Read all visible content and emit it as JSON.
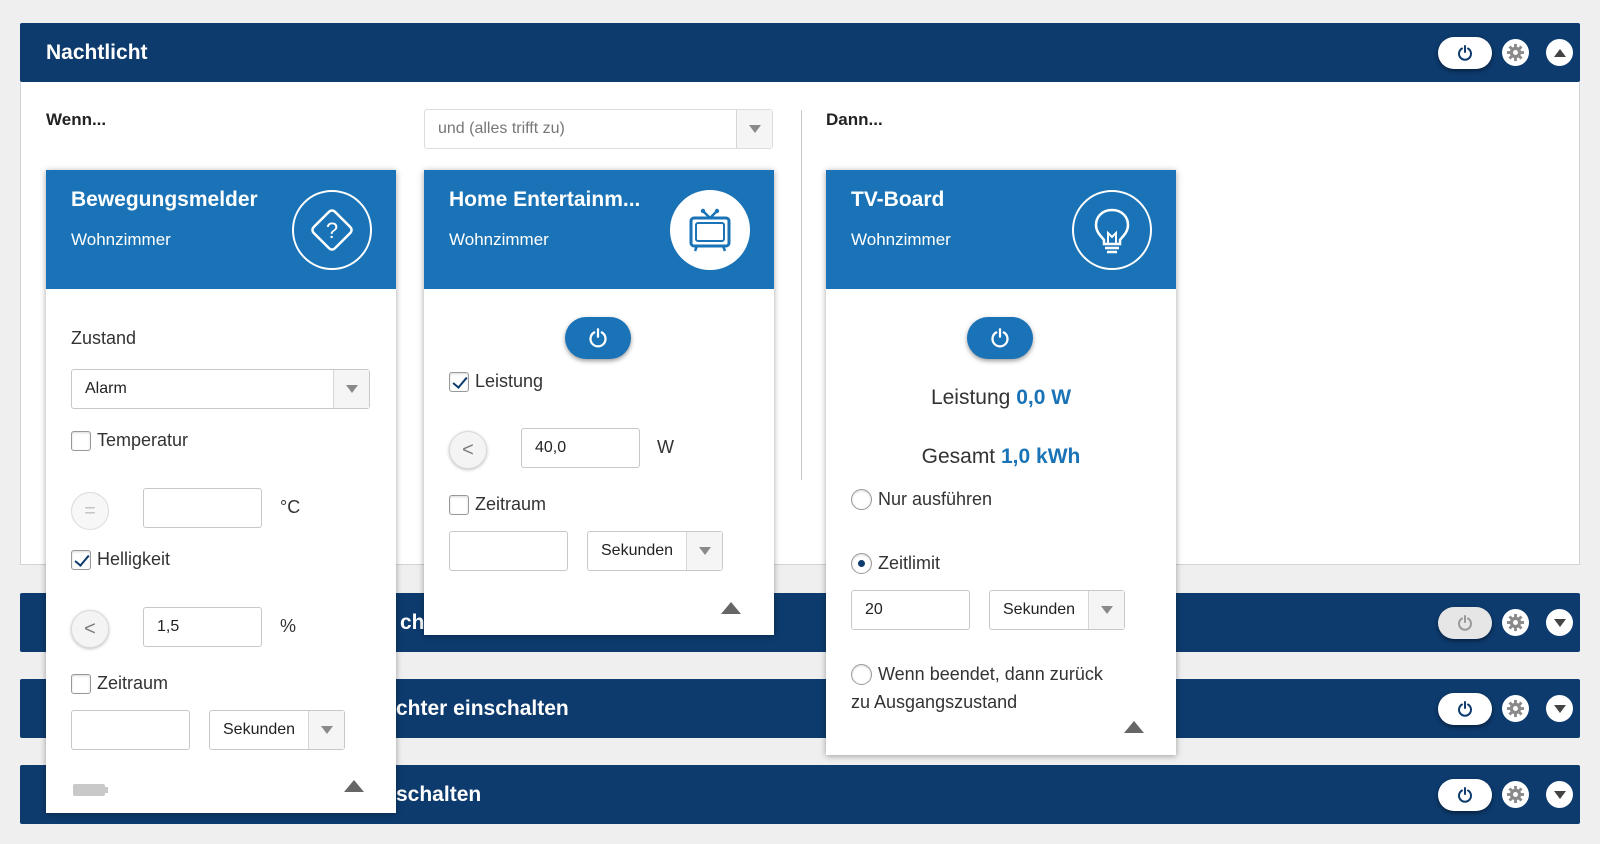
{
  "rules": [
    {
      "title": "Nachtlicht",
      "expanded": true
    },
    {
      "title": "…ch…",
      "expanded": false,
      "power": "off"
    },
    {
      "title": "…chter einschalten",
      "expanded": false,
      "power": "on"
    },
    {
      "title": "…schalten",
      "expanded": false,
      "power": "on"
    }
  ],
  "condition": {
    "when_label": "Wenn...",
    "logic_select": "und (alles trifft zu)",
    "then_label": "Dann..."
  },
  "card_motion": {
    "title": "Bewegungsmelder",
    "room": "Wohnzimmer",
    "icon": "unknown-device-icon",
    "state_label": "Zustand",
    "state_value": "Alarm",
    "temperature": {
      "label": "Temperatur",
      "checked": false,
      "operator": "=",
      "value": "",
      "unit": "°C"
    },
    "brightness": {
      "label": "Helligkeit",
      "checked": true,
      "operator": "<",
      "value": "1,5",
      "unit": "%"
    },
    "period": {
      "label": "Zeitraum",
      "checked": false,
      "value": "",
      "unit_select": "Sekunden"
    }
  },
  "card_home": {
    "title": "Home Entertainm...",
    "room": "Wohnzimmer",
    "icon": "tv-icon",
    "power": {
      "label": "Leistung",
      "checked": true,
      "operator": "<",
      "value": "40,0",
      "unit": "W"
    },
    "period": {
      "label": "Zeitraum",
      "checked": false,
      "value": "",
      "unit_select": "Sekunden"
    }
  },
  "card_tv": {
    "title": "TV-Board",
    "room": "Wohnzimmer",
    "icon": "lightbulb-icon",
    "power_label": "Leistung",
    "power_value": "0,0 W",
    "total_label": "Gesamt",
    "total_value": "1,0 kWh",
    "opt_execute": "Nur ausführen",
    "opt_timelimit": "Zeitlimit",
    "timelimit_value": "20",
    "timelimit_unit": "Sekunden",
    "opt_return_line1": "Wenn beendet, dann zurück",
    "opt_return_line2": "zu Ausgangszustand",
    "selected_option": "Zeitlimit"
  },
  "colors": {
    "header": "#0d3b6e",
    "card_header": "#1a73b6",
    "accent": "#1a73b6"
  }
}
